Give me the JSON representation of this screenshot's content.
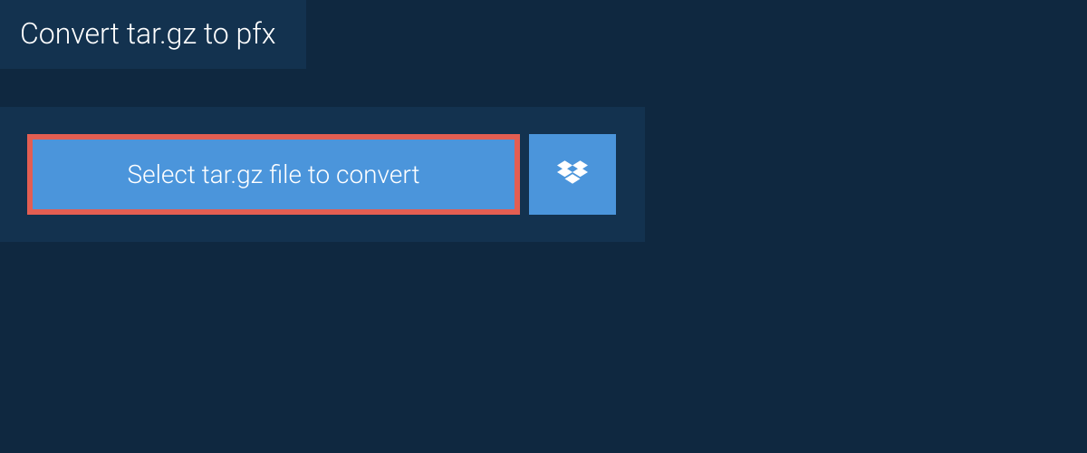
{
  "header": {
    "title": "Convert tar.gz to pfx"
  },
  "upload": {
    "select_label": "Select tar.gz file to convert"
  }
}
